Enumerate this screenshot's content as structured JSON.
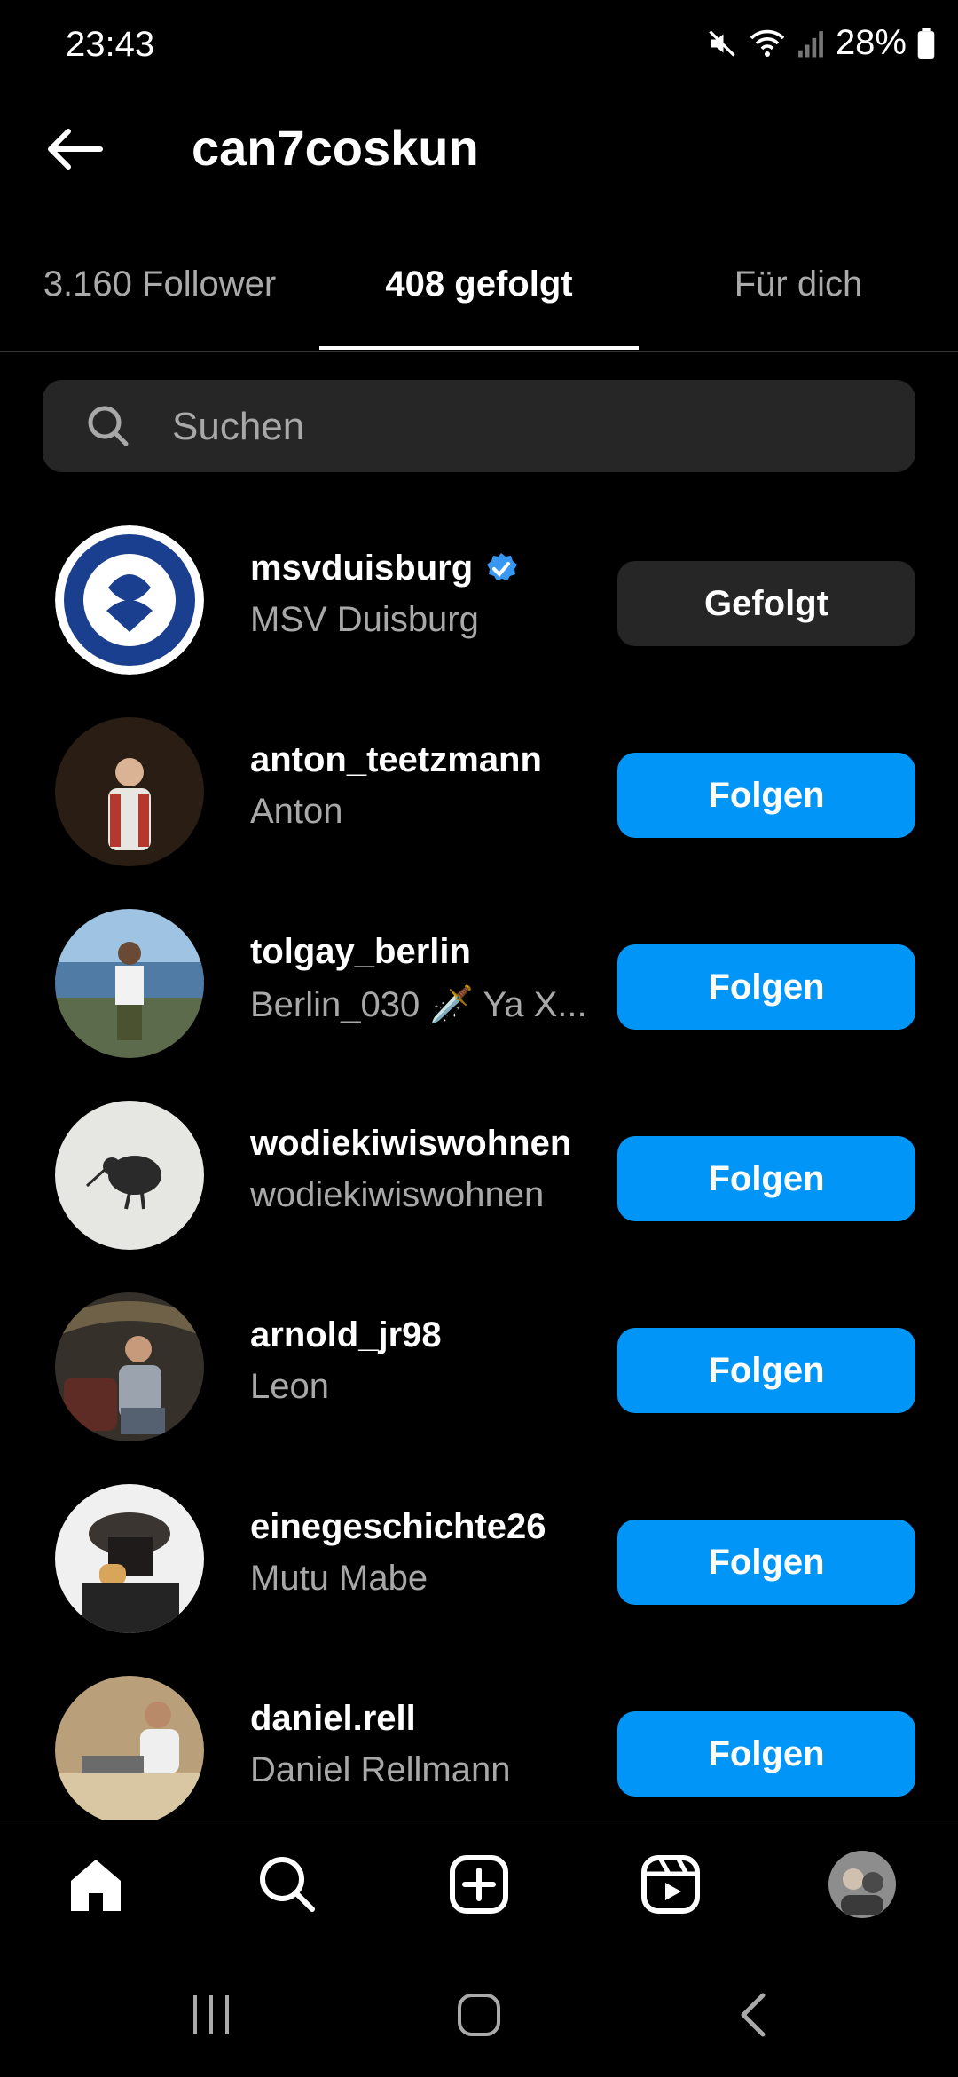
{
  "status": {
    "time": "23:43",
    "battery": "28%"
  },
  "header": {
    "title": "can7coskun"
  },
  "tabs": [
    {
      "label": "3.160 Follower"
    },
    {
      "label": "408 gefolgt"
    },
    {
      "label": "Für dich"
    }
  ],
  "search": {
    "placeholder": "Suchen"
  },
  "users": [
    {
      "username": "msvduisburg",
      "name": "MSV Duisburg",
      "verified": true,
      "button": "Gefolgt"
    },
    {
      "username": "anton_teetzmann",
      "name": "Anton",
      "button": "Folgen"
    },
    {
      "username": "tolgay_berlin",
      "name": "Berlin_030 🗡️ Ya X...",
      "button": "Folgen"
    },
    {
      "username": "wodiekiwiswohnen",
      "name": "wodiekiwiswohnen",
      "button": "Folgen"
    },
    {
      "username": "arnold_jr98",
      "name": "Leon",
      "button": "Folgen"
    },
    {
      "username": "einegeschichte26",
      "name": "Mutu Mabe",
      "button": "Folgen"
    },
    {
      "username": "daniel.rell",
      "name": "Daniel Rellmann",
      "button": "Folgen"
    }
  ],
  "colors": {
    "accent": "#0095f6",
    "verified": "#3897f0"
  },
  "nav": [
    "home-icon",
    "search-icon",
    "create-icon",
    "reels-icon",
    "profile-avatar"
  ]
}
